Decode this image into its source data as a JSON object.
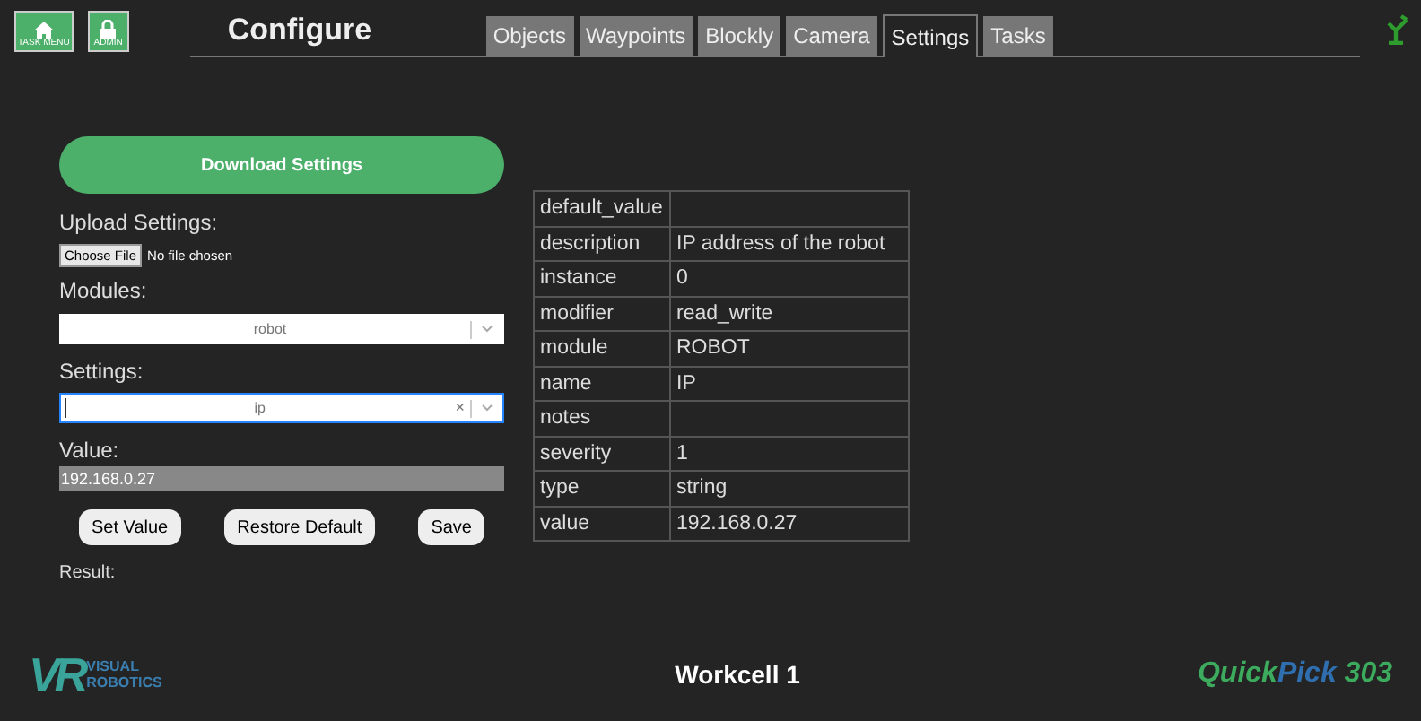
{
  "nav_buttons": [
    {
      "kind": "home",
      "label": "TASK MENU"
    },
    {
      "kind": "lock",
      "label": "ADMIN"
    }
  ],
  "title": "Configure",
  "tabs": [
    {
      "label": "Objects",
      "selected": false
    },
    {
      "label": "Waypoints",
      "selected": false
    },
    {
      "label": "Blockly",
      "selected": false
    },
    {
      "label": "Camera",
      "selected": false
    },
    {
      "label": "Settings",
      "selected": true
    },
    {
      "label": "Tasks",
      "selected": false
    }
  ],
  "download_button": "Download Settings",
  "upload": {
    "label": "Upload Settings:",
    "button": "Choose File",
    "status": "No file chosen"
  },
  "modules": {
    "label": "Modules:",
    "value": "robot",
    "focused": false,
    "clearable": false
  },
  "settings": {
    "label": "Settings:",
    "value": "ip",
    "focused": true,
    "clearable": true,
    "clear": "×"
  },
  "value": {
    "label": "Value:",
    "value": "192.168.0.27"
  },
  "buttons": [
    "Set Value",
    "Restore Default",
    "Save"
  ],
  "result_label": "Result:",
  "table": {
    "rows": [
      [
        "default_value",
        ""
      ],
      [
        "description",
        "IP address of the robot"
      ],
      [
        "instance",
        "0"
      ],
      [
        "modifier",
        "read_write"
      ],
      [
        "module",
        "ROBOT"
      ],
      [
        "name",
        "IP"
      ],
      [
        "notes",
        ""
      ],
      [
        "severity",
        "1"
      ],
      [
        "type",
        "string"
      ],
      [
        "value",
        "192.168.0.27"
      ]
    ]
  },
  "footer": {
    "logo": {
      "mark": "VR",
      "lines": [
        "VISUAL",
        "ROBOTICS"
      ]
    },
    "workcell": "Workcell 1",
    "product": [
      {
        "text": "Quick",
        "color": "#3cab5e"
      },
      {
        "text": "Pick",
        "color": "#2f6fb0"
      },
      {
        "text": " 303",
        "color": "#3cab5e"
      }
    ]
  }
}
